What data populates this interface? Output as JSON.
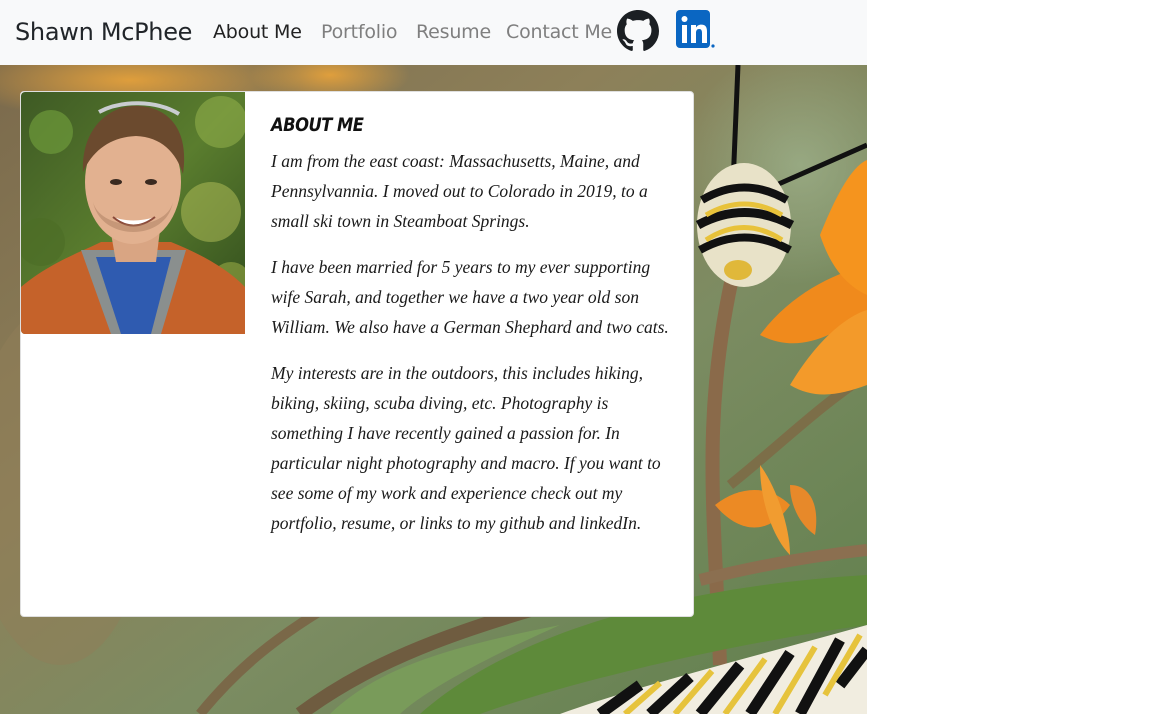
{
  "navbar": {
    "brand": "Shawn McPhee",
    "links": [
      "About Me",
      "Portfolio",
      "Resume",
      "Contact Me"
    ],
    "active_index": 0,
    "icons": [
      "github-icon",
      "linkedin-icon"
    ]
  },
  "about": {
    "title": "About Me",
    "paragraphs": [
      "I am from the east coast: Massachusetts, Maine, and Pennsylvannia. I moved out to Colorado in 2019, to a small ski town in Steamboat Springs.",
      "I have been married for 5 years to my ever supporting wife Sarah, and together we have a two year old son William. We also have a German Shephard and two cats.",
      "My interests are in the outdoors, this includes hiking, biking, skiing, scuba diving, etc. Photography is something I have recently gained a passion for. In particular night photography and macro. If you want to see some of my work and experience check out my portfolio, resume, or links to my github and linkedIn."
    ]
  },
  "colors": {
    "navbar_bg": "#f8f9fa",
    "linkedin": "#0a66c2",
    "github": "#1b1f23"
  }
}
